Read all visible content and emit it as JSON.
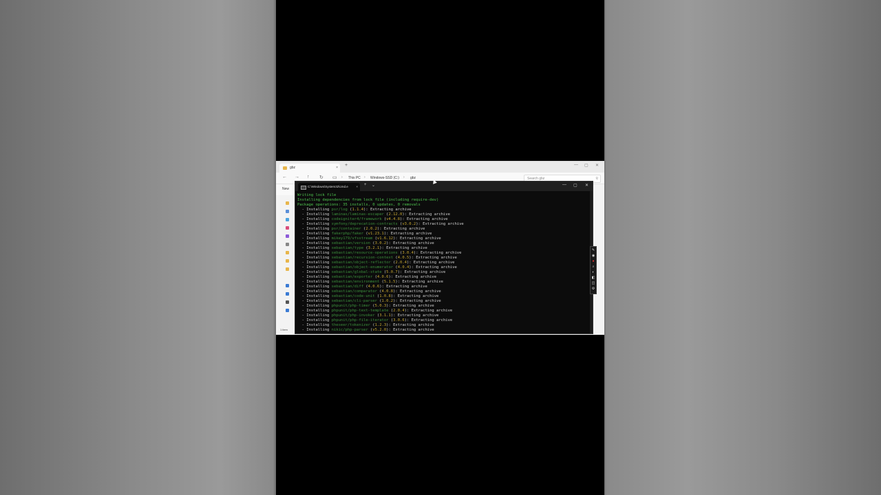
{
  "explorer": {
    "tab_title": "gbz",
    "tab_close": "×",
    "new_tab": "+",
    "window_controls": [
      "—",
      "▢",
      "✕"
    ],
    "nav_icons": [
      "←",
      "→",
      "↑",
      "↻",
      "▭"
    ],
    "breadcrumb": [
      "This PC",
      "Windows-SSD (C:)",
      "gbz"
    ],
    "breadcrumb_sep": "›",
    "search_placeholder": "Search gbz",
    "search_icon": "⚲",
    "new_label": "New",
    "status": "1 item"
  },
  "terminal": {
    "tab_title": "C:\\Windows\\System32\\cmd.e",
    "tab_close": "×",
    "new_tab": "+",
    "dropdown": "⌄",
    "window_controls": [
      "—",
      "▢",
      "✕"
    ],
    "lines": [
      {
        "kind": "plain",
        "text": "Writing lock file"
      },
      {
        "kind": "plain",
        "text": "Installing dependencies from lock file (including require-dev)"
      },
      {
        "kind": "plain",
        "text": "Package operations: 35 installs, 0 updates, 0 removals"
      },
      {
        "kind": "install",
        "pkg": "psr/log",
        "ver": "1.1.4"
      },
      {
        "kind": "install",
        "pkg": "laminas/laminas-escaper",
        "ver": "2.12.0"
      },
      {
        "kind": "install",
        "pkg": "codeigniter4/framework",
        "ver": "v4.4.8"
      },
      {
        "kind": "install",
        "pkg": "symfony/deprecation-contracts",
        "ver": "v3.0.2"
      },
      {
        "kind": "install",
        "pkg": "psr/container",
        "ver": "2.0.2"
      },
      {
        "kind": "install",
        "pkg": "fakerphp/faker",
        "ver": "v1.23.1"
      },
      {
        "kind": "install",
        "pkg": "mikey179/vfsstream",
        "ver": "v1.6.12"
      },
      {
        "kind": "install",
        "pkg": "sebastian/version",
        "ver": "3.0.2"
      },
      {
        "kind": "install",
        "pkg": "sebastian/type",
        "ver": "3.2.1"
      },
      {
        "kind": "install",
        "pkg": "sebastian/resource-operations",
        "ver": "3.0.4"
      },
      {
        "kind": "install",
        "pkg": "sebastian/recursion-context",
        "ver": "4.0.5"
      },
      {
        "kind": "install",
        "pkg": "sebastian/object-reflector",
        "ver": "2.0.4"
      },
      {
        "kind": "install",
        "pkg": "sebastian/object-enumerator",
        "ver": "4.0.4"
      },
      {
        "kind": "install",
        "pkg": "sebastian/global-state",
        "ver": "5.0.7"
      },
      {
        "kind": "install",
        "pkg": "sebastian/exporter",
        "ver": "4.0.6"
      },
      {
        "kind": "install",
        "pkg": "sebastian/environment",
        "ver": "5.1.5"
      },
      {
        "kind": "install",
        "pkg": "sebastian/diff",
        "ver": "4.0.6"
      },
      {
        "kind": "install",
        "pkg": "sebastian/comparator",
        "ver": "4.0.8"
      },
      {
        "kind": "install",
        "pkg": "sebastian/code-unit",
        "ver": "1.0.8"
      },
      {
        "kind": "install",
        "pkg": "sebastian/cli-parser",
        "ver": "1.0.2"
      },
      {
        "kind": "install",
        "pkg": "phpunit/php-timer",
        "ver": "5.0.3"
      },
      {
        "kind": "install",
        "pkg": "phpunit/php-text-template",
        "ver": "2.0.4"
      },
      {
        "kind": "install",
        "pkg": "phpunit/php-invoker",
        "ver": "3.1.1"
      },
      {
        "kind": "install",
        "pkg": "phpunit/php-file-iterator",
        "ver": "3.0.6"
      },
      {
        "kind": "install",
        "pkg": "theseer/tokenizer",
        "ver": "1.2.3"
      },
      {
        "kind": "install",
        "pkg": "nikic/php-parser",
        "ver": "v5.2.0"
      }
    ],
    "install_prefix": "  - Installing ",
    "install_suffix": ": Extracting archive"
  },
  "recorder_toolbar": [
    "✎",
    "◉",
    "●",
    "⌕",
    "◐",
    "◧",
    "◫",
    "⚙"
  ],
  "colors": {
    "terminal_bg": "#0c0c0c",
    "green": "#4ec24e",
    "package_green": "#3c8f3c",
    "version_yellow": "#c8a832"
  }
}
